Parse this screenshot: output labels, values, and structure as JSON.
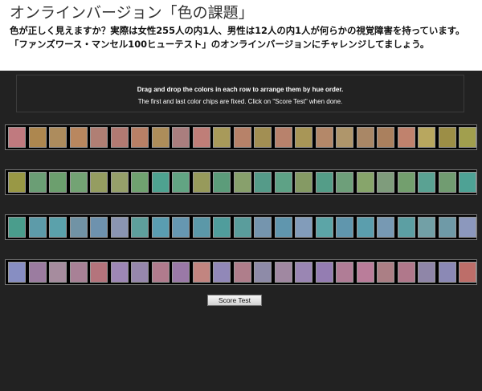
{
  "page": {
    "title": "オンラインバージョン「色の課題」",
    "intro": "色が正しく見えますか？実際は女性255人の内1人、男性は12人の内1人が何らかの視覚障害を持っています。「ファンズワース・マンセル100ヒューテスト」のオンラインバージョンにチャレンジしてましょう。"
  },
  "test": {
    "instruction_main": "Drag and drop the colors in each row to arrange them by hue order.",
    "instruction_sub": "The first and last color chips are fixed. Click on \"Score Test\" when done.",
    "score_button_label": "Score Test",
    "rows": [
      {
        "name": "row-1",
        "chips": [
          "#c07a7f",
          "#ad874f",
          "#ad8c5d",
          "#b9875f",
          "#b07f74",
          "#b27a72",
          "#b88066",
          "#ad8d5a",
          "#aa7e7e",
          "#bf7e78",
          "#a89a5a",
          "#b78269",
          "#a28f53",
          "#b8826c",
          "#a89657",
          "#b48869",
          "#af966b",
          "#a98766",
          "#aa805e",
          "#c0826d",
          "#b8a75f",
          "#9c8e46",
          "#a19f4e"
        ]
      },
      {
        "name": "row-2",
        "chips": [
          "#999845",
          "#6b9e75",
          "#6c9f6e",
          "#73a374",
          "#959d61",
          "#96a06a",
          "#70a270",
          "#4ea290",
          "#62a483",
          "#979a5b",
          "#5c9c7a",
          "#88a06c",
          "#559b89",
          "#5ea286",
          "#859a64",
          "#549d88",
          "#6e9f7a",
          "#87a56b",
          "#7f9c7c",
          "#739f6e",
          "#5aa293",
          "#719c71",
          "#4ea295"
        ]
      },
      {
        "name": "row-3",
        "chips": [
          "#4a9d8c",
          "#5d9ba9",
          "#5ba1ab",
          "#7193a5",
          "#6e92ae",
          "#8a95b2",
          "#5e9f9c",
          "#5a9db1",
          "#6697b1",
          "#5b98a8",
          "#509d9c",
          "#5a9d9c",
          "#7595ae",
          "#6096ae",
          "#829cba",
          "#5ca5a7",
          "#6096ad",
          "#5b9ead",
          "#7799b3",
          "#5c9fa3",
          "#72a0a6",
          "#6f9aa7",
          "#8c98bd"
        ]
      },
      {
        "name": "row-4",
        "chips": [
          "#878ec2",
          "#9b7ca0",
          "#a68c9e",
          "#a88196",
          "#b4747c",
          "#9d87b5",
          "#9687ac",
          "#b07b8d",
          "#9a79a7",
          "#c28580",
          "#9188b8",
          "#af7e8b",
          "#8e8ba8",
          "#a088a1",
          "#9a86b3",
          "#947db2",
          "#b07d96",
          "#ba7d9a",
          "#ab7f85",
          "#b0788b",
          "#8f86a8",
          "#8b89b5",
          "#bd6e69"
        ]
      }
    ]
  }
}
